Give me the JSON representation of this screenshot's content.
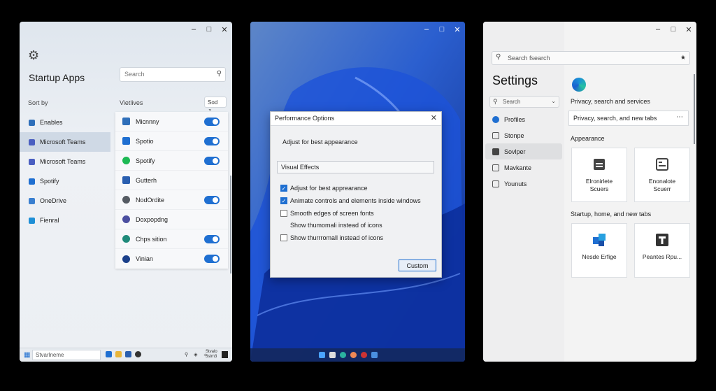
{
  "window1": {
    "title": "Startup Apps",
    "search_placeholder": "Search",
    "sort_by": "Sort by",
    "view_label": "Vietlives",
    "sort_button": "Sod",
    "left_items": [
      {
        "label": "Enables",
        "color": "#2f6fba"
      },
      {
        "label": "Microsoft Teams",
        "color": "#4a5fc1",
        "selected": true
      },
      {
        "label": "Microsoft Teams",
        "color": "#4a5fc1"
      },
      {
        "label": "Spotify",
        "color": "#1f6fd1"
      },
      {
        "label": "OneDrive",
        "color": "#3a7fd0"
      },
      {
        "label": "Fienral",
        "color": "#1f8fd6"
      }
    ],
    "apps": [
      {
        "label": "Micnnny",
        "color": "#2f6fba",
        "toggle": true
      },
      {
        "label": "Spotio",
        "color": "#1f6fd1",
        "toggle": true
      },
      {
        "label": "Spotify",
        "color": "#1db954",
        "toggle": true
      },
      {
        "label": "Gutterh",
        "color": "#2a5fb0",
        "toggle": false
      },
      {
        "label": "NodOrdite",
        "color": "#555b63",
        "toggle": true
      },
      {
        "label": "Doxpopdng",
        "color": "#4b4fa0",
        "toggle": false
      },
      {
        "label": "Chps sition",
        "color": "#1f8a7a",
        "toggle": true
      },
      {
        "label": "Vinian",
        "color": "#1a3f8a",
        "toggle": true
      }
    ],
    "taskbar": {
      "search": "Stvarlneme",
      "clock_line1": "Stvalo",
      "clock_line2": "5stm3"
    }
  },
  "window2": {
    "dialog_title": "Performance Options",
    "adjust_text": "Adjust for best appearance",
    "visual_effects": "Visual Effects",
    "options": [
      {
        "label": "Adjust for best apprearance",
        "checked": true,
        "box": true
      },
      {
        "label": "Animate controls and elements inside windows",
        "checked": true,
        "box": true
      },
      {
        "label": "Smooth edges of screen fonts",
        "checked": false,
        "box": true
      },
      {
        "label": "Show thumomali instead of icons",
        "checked": false,
        "box": false
      },
      {
        "label": "Show thurrromall instead of icons",
        "checked": false,
        "box": true
      }
    ],
    "custom_button": "Custom"
  },
  "window3": {
    "top_search": "Search fsearch",
    "title": "Settings",
    "left_search": "Search",
    "nav": [
      {
        "label": "Profiles",
        "color": "#1f6fd1"
      },
      {
        "label": "Stonpe",
        "color": "#555b63"
      },
      {
        "label": "Sovlper",
        "color": "#444",
        "selected": true
      },
      {
        "label": "Mavkante",
        "color": "#555"
      },
      {
        "label": "Younuts",
        "color": "#555"
      }
    ],
    "privacy_label": "Privacy, search and services",
    "privacy_box": "Privacy, search, and new tabs",
    "appearance_label": "Appearance",
    "cards_row1": [
      {
        "line1": "Elronirlete",
        "line2": "Scuers"
      },
      {
        "line1": "Enonalote",
        "line2": "Scuerr"
      }
    ],
    "startup_label": "Startup, home, and new tabs",
    "cards_row2": [
      {
        "line1": "Nesde Erfige",
        "line2": ""
      },
      {
        "line1": "Peantes Rpu...",
        "line2": ""
      }
    ]
  }
}
